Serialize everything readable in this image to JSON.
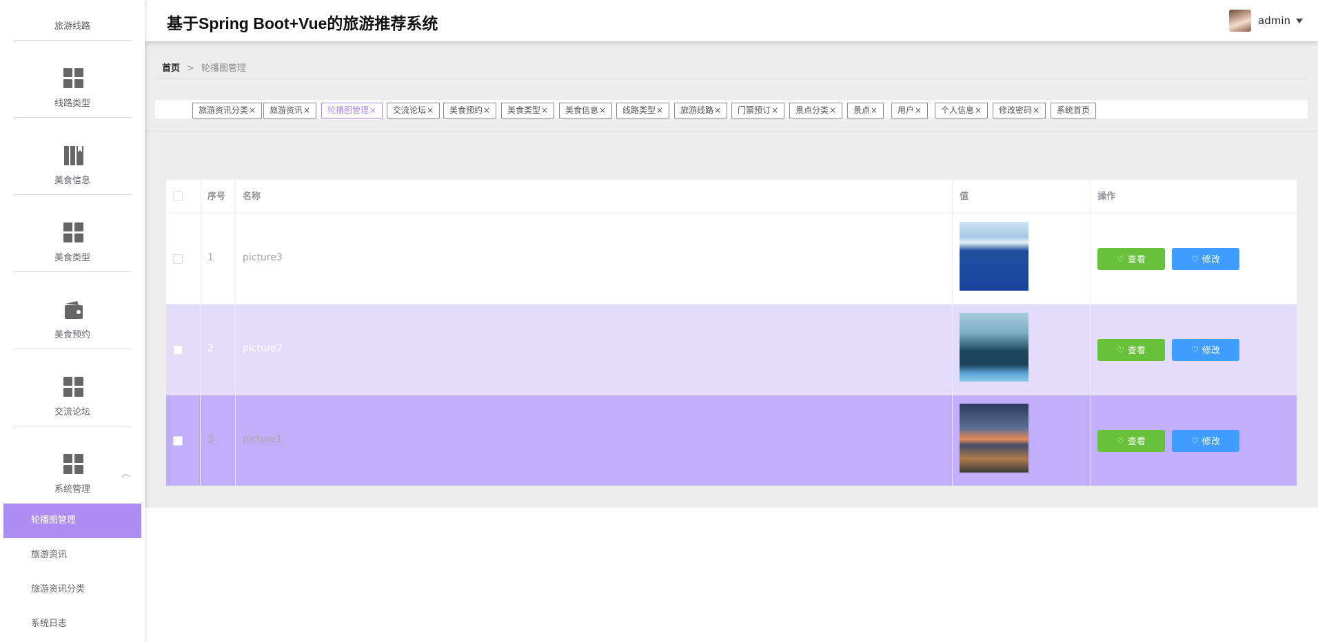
{
  "header": {
    "title": "基于Spring Boot+Vue的旅游推荐系统",
    "username": "admin"
  },
  "sidebar": {
    "items": [
      {
        "label": "旅游线路",
        "icon": "route-icon"
      },
      {
        "label": "线路类型",
        "icon": "grid-icon"
      },
      {
        "label": "美食信息",
        "icon": "book-icon"
      },
      {
        "label": "美食类型",
        "icon": "grid-icon"
      },
      {
        "label": "美食预约",
        "icon": "wallet-icon"
      },
      {
        "label": "交流论坛",
        "icon": "grid-icon"
      },
      {
        "label": "系统管理",
        "icon": "grid-icon"
      }
    ],
    "submenu": [
      "轮播图管理",
      "旅游资讯",
      "旅游资讯分类",
      "系统日志"
    ]
  },
  "breadcrumb": {
    "home": "首页",
    "separator": ">",
    "current": "轮播图管理"
  },
  "tags": [
    {
      "label": "旅游资讯分类",
      "closable": true
    },
    {
      "label": "旅游资讯",
      "closable": true
    },
    {
      "label": "轮播图管理",
      "closable": true,
      "active": true
    },
    {
      "label": "交流论坛",
      "closable": true
    },
    {
      "label": "美食预约",
      "closable": true
    },
    {
      "label": "美食类型",
      "closable": true
    },
    {
      "label": "美食信息",
      "closable": true
    },
    {
      "label": "线路类型",
      "closable": true
    },
    {
      "label": "旅游线路",
      "closable": true
    },
    {
      "label": "门票预订",
      "closable": true
    },
    {
      "label": "景点分类",
      "closable": true
    },
    {
      "label": "景点",
      "closable": true
    },
    {
      "label": "用户",
      "closable": true
    },
    {
      "label": "个人信息",
      "closable": true
    },
    {
      "label": "修改密码",
      "closable": true
    },
    {
      "label": "系统首页",
      "closable": false
    }
  ],
  "table": {
    "columns": [
      "序号",
      "名称",
      "值",
      "操作"
    ],
    "rows": [
      {
        "index": "1",
        "name": "picture3",
        "image": "snowy-mountain-lake"
      },
      {
        "index": "2",
        "name": "picture2",
        "image": "snowy-forest"
      },
      {
        "index": "3",
        "name": "picture1",
        "image": "coastal-city-sunset"
      }
    ],
    "actions": {
      "view": "查看",
      "edit": "修改"
    }
  },
  "colors": {
    "accent": "#ad8df1",
    "view_button": "#67c23a",
    "edit_button": "#409eff"
  }
}
